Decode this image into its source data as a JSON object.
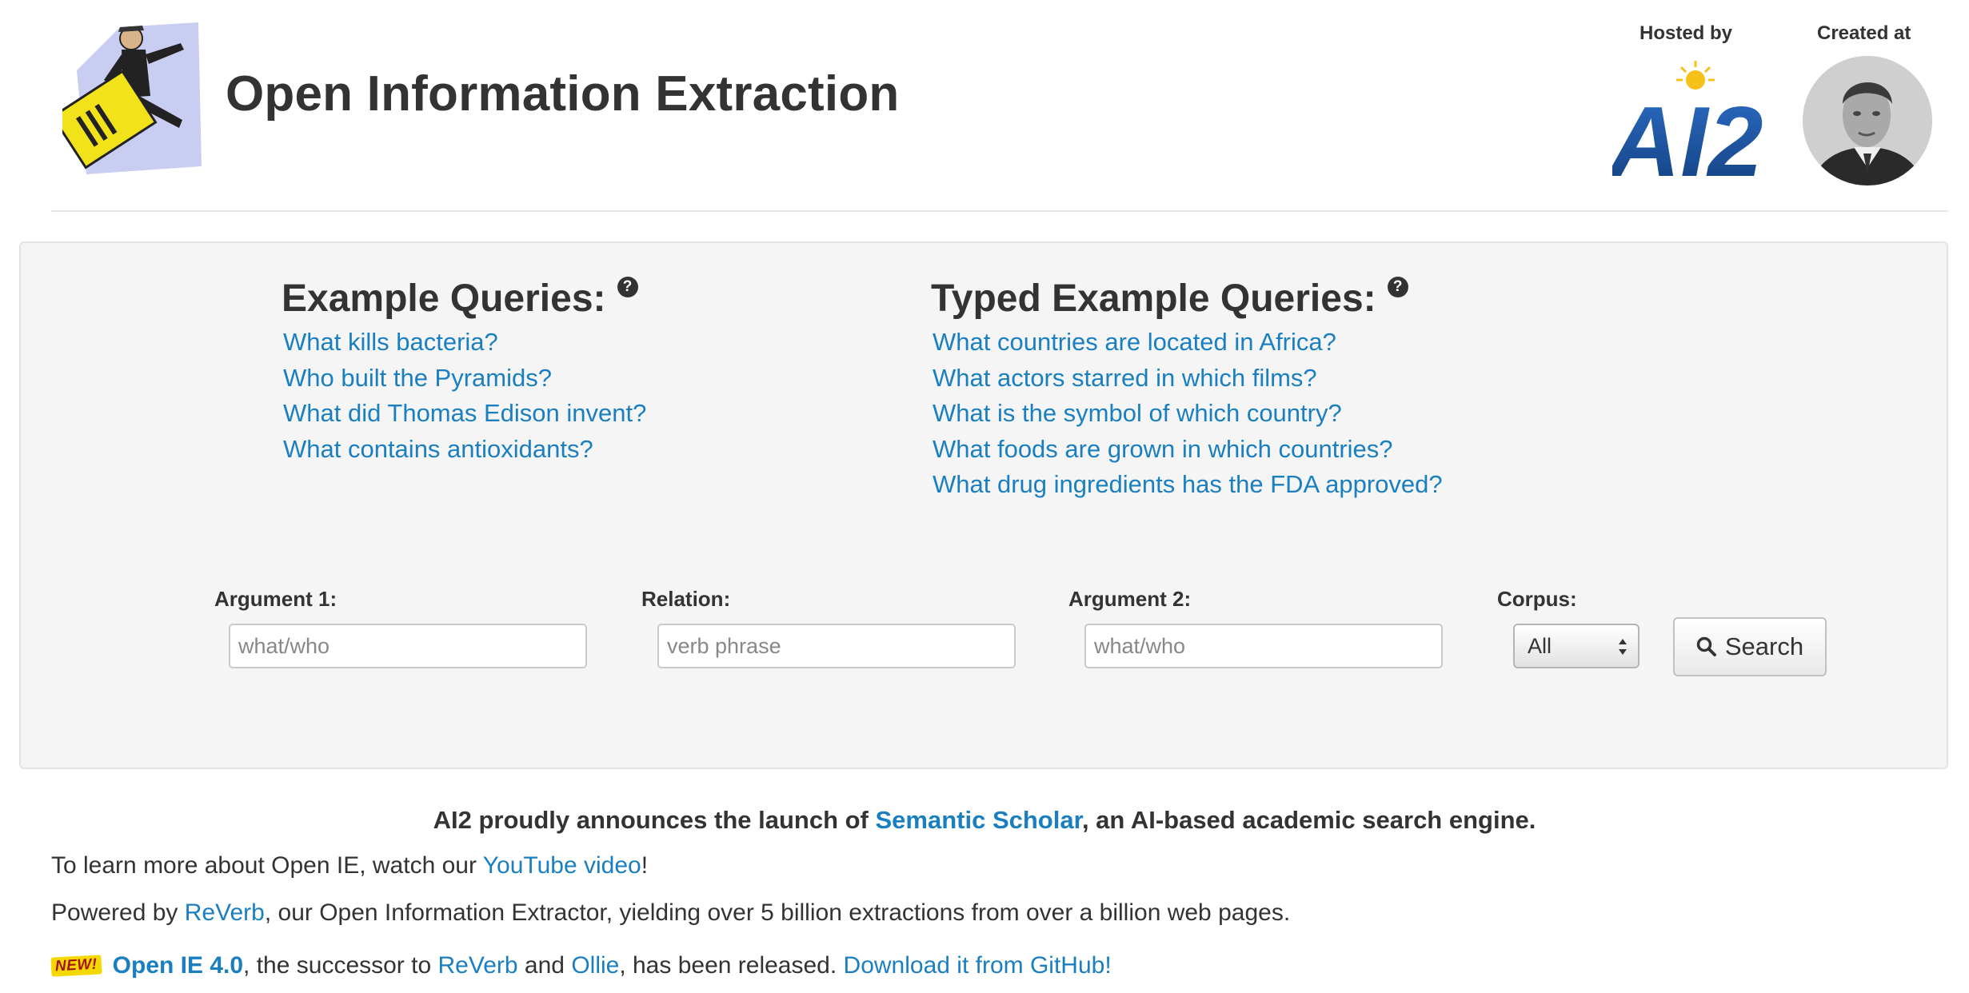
{
  "header": {
    "title": "Open Information Extraction",
    "hosted_by_label": "Hosted by",
    "created_at_label": "Created at",
    "ai2_logo_text": "AI2"
  },
  "examples": {
    "heading": "Example Queries:",
    "help_glyph": "?",
    "items": [
      "What kills bacteria?",
      "Who built the Pyramids?",
      "What did Thomas Edison invent?",
      "What contains antioxidants?"
    ]
  },
  "typed_examples": {
    "heading": "Typed Example Queries:",
    "help_glyph": "?",
    "items": [
      "What countries are located in Africa?",
      "What actors starred in which films?",
      "What is the symbol of which country?",
      "What foods are grown in which countries?",
      "What drug ingredients has the FDA approved?"
    ]
  },
  "form": {
    "arg1_label": "Argument 1:",
    "arg1_placeholder": "what/who",
    "relation_label": "Relation:",
    "relation_placeholder": "verb phrase",
    "arg2_label": "Argument 2:",
    "arg2_placeholder": "what/who",
    "corpus_label": "Corpus:",
    "corpus_value": "All",
    "search_label": "Search"
  },
  "announcement": {
    "prefix": "AI2 proudly announces the launch of ",
    "link": "Semantic Scholar",
    "suffix": ", an AI-based academic search engine."
  },
  "learn_more": {
    "prefix": "To learn more about Open IE, watch our ",
    "link": "YouTube video",
    "suffix": "!"
  },
  "powered_by": {
    "prefix": "Powered by ",
    "link": "ReVerb",
    "suffix": ", our Open Information Extractor, yielding over 5 billion extractions from over a billion web pages."
  },
  "release": {
    "badge": "NEW!",
    "link_openie": "Open IE 4.0",
    "text1": ", the successor to ",
    "link_reverb": "ReVerb",
    "text2": " and ",
    "link_ollie": "Ollie",
    "text3": ", has been released. ",
    "link_download": "Download it from GitHub!"
  },
  "colors": {
    "link": "#1a7fc1",
    "text": "#333333",
    "well_bg": "#f5f5f5",
    "badge_bg": "#f5d800"
  },
  "icons": [
    "logo-figure-icon",
    "help-icon",
    "search-icon",
    "select-arrows-icon"
  ]
}
